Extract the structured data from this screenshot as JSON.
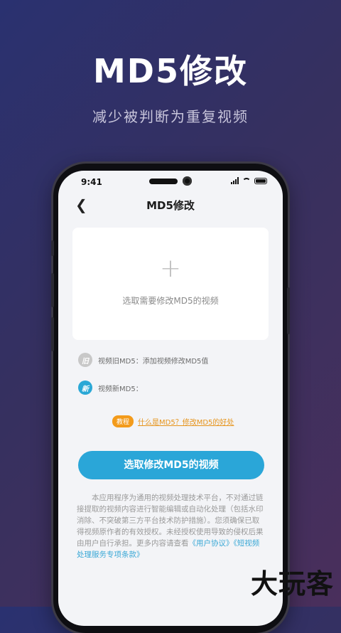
{
  "hero": {
    "title": "MD5修改",
    "subtitle": "减少被判断为重复视频"
  },
  "status_bar": {
    "time": "9:41"
  },
  "nav": {
    "back_icon": "chevron-left-icon",
    "title": "MD5修改"
  },
  "picker": {
    "plus_icon": "+",
    "label": "选取需要修改MD5的视频"
  },
  "md5_old": {
    "badge": "旧",
    "text": "视频旧MD5：添加视频修改MD5值"
  },
  "md5_new": {
    "badge": "新",
    "text": "视频新MD5："
  },
  "tutorial": {
    "badge": "教程",
    "link": "什么是MD5？修改MD5的好处"
  },
  "primary_button": {
    "label": "选取修改MD5的视频"
  },
  "disclaimer": {
    "body": "本应用程序为通用的视频处理技术平台，不对通过链接提取的视频内容进行智能编辑或自动化处理（包括水印消除、不突破第三方平台技术防护措施）。您须确保已取得视频原作者的有效授权。未经授权使用导致的侵权后果由用户自行承担。更多内容请查看",
    "link1": "《用户协议》",
    "link2": "《短视频处理服务专项条款》"
  },
  "watermark": "大玩客",
  "colors": {
    "accent": "#2aa6d8",
    "tutorial_orange": "#f39b1b",
    "background_start": "#2a3170",
    "background_end": "#4a2f5c"
  }
}
